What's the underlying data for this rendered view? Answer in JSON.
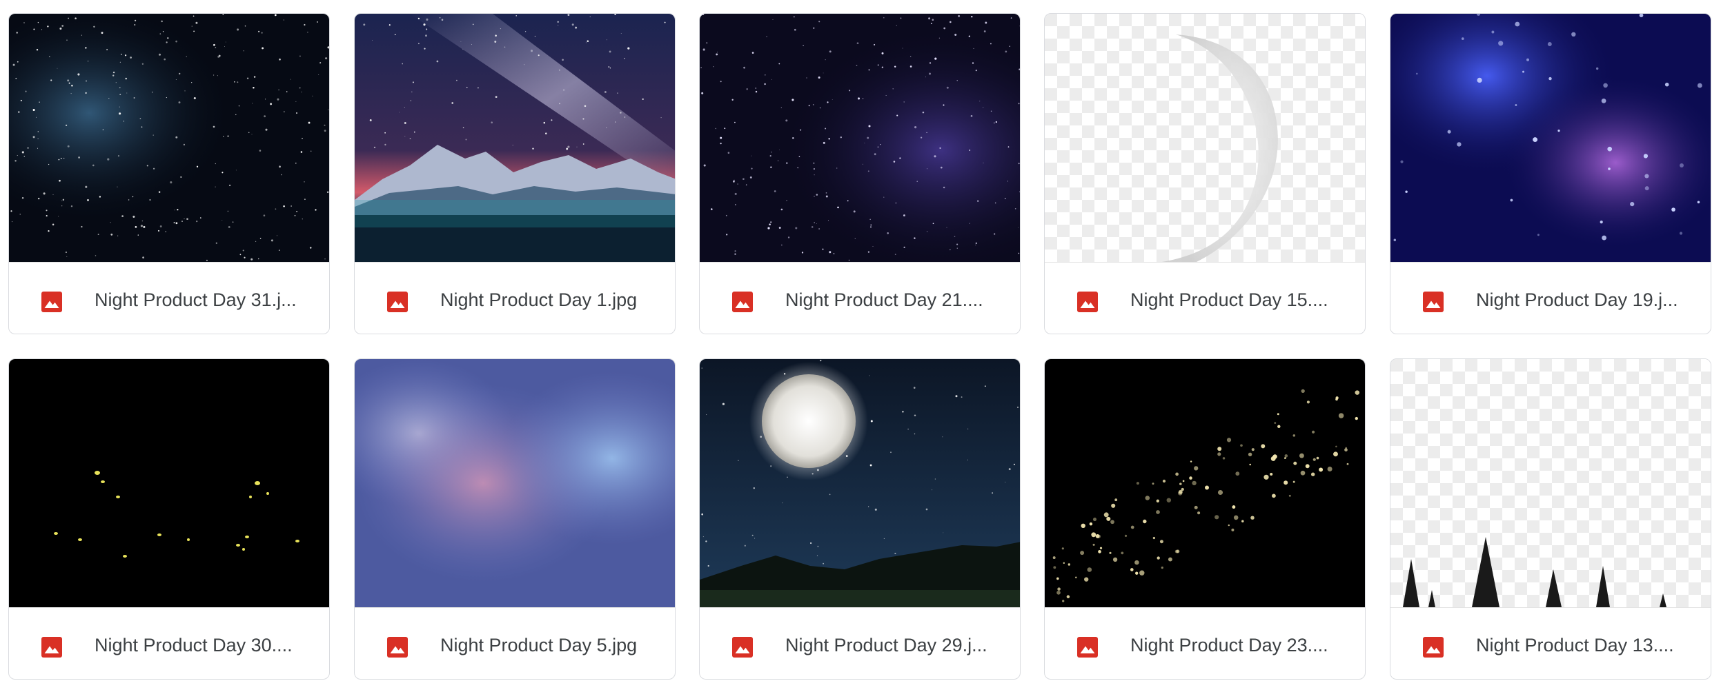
{
  "files": [
    {
      "name": "Night Product Day 31.j...",
      "icon": "image-file-icon"
    },
    {
      "name": "Night Product Day 1.jpg",
      "icon": "image-file-icon"
    },
    {
      "name": "Night Product Day 21....",
      "icon": "image-file-icon"
    },
    {
      "name": "Night Product Day 15....",
      "icon": "image-file-icon"
    },
    {
      "name": "Night Product Day 19.j...",
      "icon": "image-file-icon"
    },
    {
      "name": "Night Product Day 30....",
      "icon": "image-file-icon"
    },
    {
      "name": "Night Product Day 5.jpg",
      "icon": "image-file-icon"
    },
    {
      "name": "Night Product Day 29.j...",
      "icon": "image-file-icon"
    },
    {
      "name": "Night Product Day 23....",
      "icon": "image-file-icon"
    },
    {
      "name": "Night Product Day 13....",
      "icon": "image-file-icon"
    }
  ],
  "colors": {
    "icon_red": "#d93025",
    "card_border": "#dadce0",
    "text": "#3c4043"
  }
}
